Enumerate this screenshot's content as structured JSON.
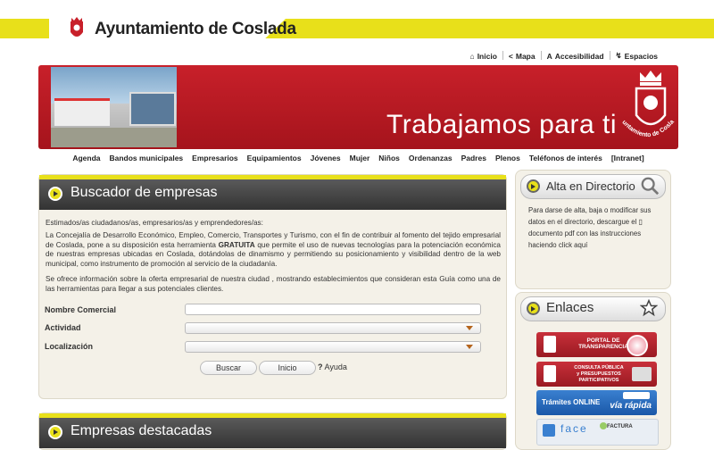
{
  "header": {
    "site_title": "Ayuntamiento de Coslada",
    "util_nav": [
      {
        "icon": "home-icon",
        "label": "Inicio"
      },
      {
        "icon": "share-icon",
        "label": "Mapa"
      },
      {
        "icon": "accessibility-icon",
        "label": "Accesibilidad"
      },
      {
        "icon": "spaces-icon",
        "label": "Espacios"
      }
    ]
  },
  "banner": {
    "slogan": "Trabajamos para ti",
    "crest_caption": "Ayuntamiento de Coslada"
  },
  "main_nav": [
    "Agenda",
    "Bandos municipales",
    "Empresarios",
    "Equipamientos",
    "Jóvenes",
    "Mujer",
    "Niños",
    "Ordenanzas",
    "Padres",
    "Plenos",
    "Teléfonos de interés",
    "[Intranet]"
  ],
  "search_panel": {
    "title": "Buscador de empresas",
    "greeting": "Estimados/as ciudadanos/as, empresarios/as y emprendedores/as:",
    "paragraph1_a": "La Concejalía de Desarrollo Económico, Empleo, Comercio, Transportes y Turismo, con el fin de contribuir al fomento del tejido empresarial de Coslada, pone a su disposición esta herramienta ",
    "paragraph1_bold": "GRATUITA",
    "paragraph1_b": " que permite el uso de nuevas tecnologías para la potenciación económica de nuestras empresas ubicadas en Coslada, dotándolas de dinamismo y permitiendo su posicionamiento y visibilidad dentro de la web municipal, como instrumento de promoción al servicio de la ciudadanía.",
    "paragraph2": "Se ofrece información sobre la oferta empresarial de nuestra ciudad , mostrando establecimientos que consideran esta Guía como una de las herramientas para llegar a sus potenciales clientes.",
    "fields": {
      "nombre_label": "Nombre Comercial",
      "nombre_value": "",
      "actividad_label": "Actividad",
      "actividad_value": "",
      "localizacion_label": "Localización",
      "localizacion_value": ""
    },
    "buttons": {
      "buscar": "Buscar",
      "inicio": "Inicio",
      "ayuda": "Ayuda"
    }
  },
  "featured_panel": {
    "title": "Empresas destacadas"
  },
  "directory_panel": {
    "title": "Alta en Directorio",
    "text_a": "Para darse de alta, baja o modificar sus datos en el directorio, descargue el ",
    "text_b": " documento pdf con las instrucciones haciendo ",
    "text_link": "click aquí"
  },
  "links_panel": {
    "title": "Enlaces",
    "items": [
      {
        "label1": "PORTAL DE",
        "label2": "TRANSPARENCIA",
        "color": "#b8242c"
      },
      {
        "label1": "CONSULTA PÚBLICA",
        "label2": "y PRESUPUESTOS PARTICIPATIVOS",
        "color": "#b8242c"
      },
      {
        "label1": "Trámites ONLINE",
        "label2": "vía rápida",
        "color": "#2a6ab8"
      },
      {
        "label1": "face",
        "label2": "FACTURA",
        "color": "#e9eef4"
      }
    ]
  },
  "colors": {
    "brand_yellow": "#e8e01a",
    "brand_red": "#c8202a",
    "panel_dark": "#333333"
  }
}
